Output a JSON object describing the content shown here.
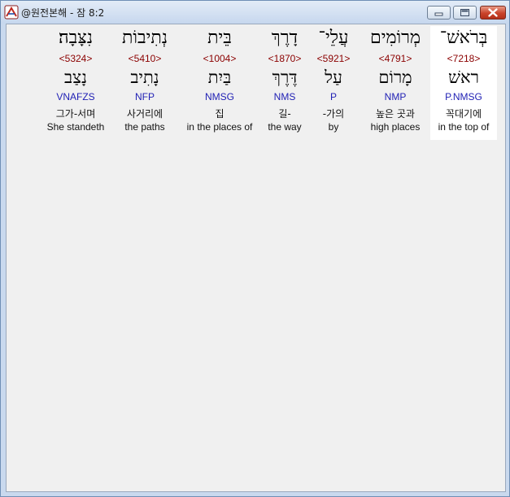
{
  "window": {
    "title": "@원전본해 - 잠 8:2"
  },
  "words": [
    {
      "hebrew": "בְּרֹאשׁ־",
      "strong": "<7218>",
      "lemma": "ראשׁ",
      "morph": "P.NMSG",
      "korean": "꼭대기에",
      "english": "in the top of"
    },
    {
      "hebrew": "מְרוֹמִים",
      "strong": "<4791>",
      "lemma": "מָרוֹם",
      "morph": "NMP",
      "korean": "높은 곳과",
      "english": "high places"
    },
    {
      "hebrew": "עֲלֵי־",
      "strong": "<5921>",
      "lemma": "עַל",
      "morph": "P",
      "korean": "-가의",
      "english": "by"
    },
    {
      "hebrew": "דָרֶךְ",
      "strong": "<1870>",
      "lemma": "דֶּרֶךְ",
      "morph": "NMS",
      "korean": "길-",
      "english": "the way"
    },
    {
      "hebrew": "בֵּית",
      "strong": "<1004>",
      "lemma": "בַּיִת",
      "morph": "NMSG",
      "korean": "집",
      "english": "in the places of"
    },
    {
      "hebrew": "נְתִיבוֹת",
      "strong": "<5410>",
      "lemma": "נָתִיב",
      "morph": "NFP",
      "korean": "사거리에",
      "english": "the paths"
    },
    {
      "hebrew": "נִצָּבָה׃",
      "strong": "<5324>",
      "lemma": "נָצַב",
      "morph": "VNAFZS",
      "korean": "그가-서며",
      "english": "She standeth"
    }
  ]
}
